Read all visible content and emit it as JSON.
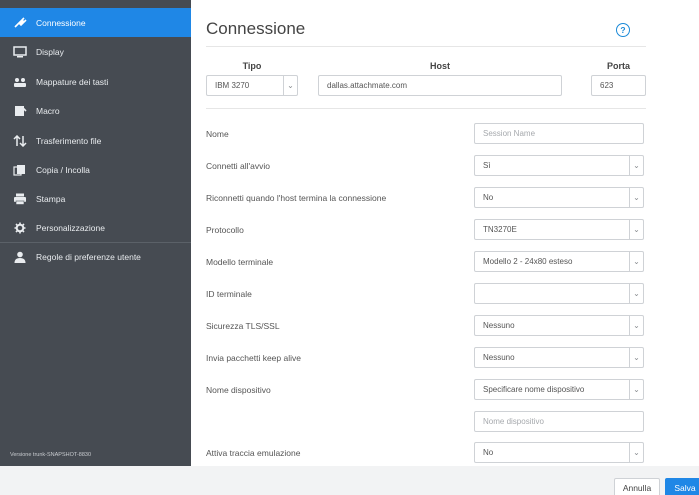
{
  "sidebar": {
    "items": [
      {
        "label": "Connessione",
        "icon": "plug-icon",
        "active": true
      },
      {
        "label": "Display",
        "icon": "monitor-icon"
      },
      {
        "label": "Mappature dei tasti",
        "icon": "keymap-icon"
      },
      {
        "label": "Macro",
        "icon": "macro-icon"
      },
      {
        "label": "Trasferimento file",
        "icon": "transfer-icon"
      },
      {
        "label": "Copia / Incolla",
        "icon": "copy-icon"
      },
      {
        "label": "Stampa",
        "icon": "printer-icon"
      },
      {
        "label": "Personalizzazione",
        "icon": "gear-icon"
      },
      {
        "label": "Regole di preferenze utente",
        "icon": "user-icon"
      }
    ],
    "version": "Versione trunk-SNAPSHOT-8830"
  },
  "main": {
    "title": "Connessione",
    "help_glyph": "?",
    "columns": {
      "tipo": "Tipo",
      "host": "Host",
      "porta": "Porta"
    },
    "tipo_value": "IBM 3270",
    "host_value": "dallas.attachmate.com",
    "porta_value": "623",
    "fields": [
      {
        "label": "Nome",
        "placeholder": "Session Name"
      },
      {
        "label": "Connetti all'avvio",
        "value": "Sì"
      },
      {
        "label": "Riconnetti quando l'host termina la connessione",
        "value": "No"
      },
      {
        "label": "Protocollo",
        "value": "TN3270E"
      },
      {
        "label": "Modello terminale",
        "value": "Modello 2 - 24x80 esteso"
      },
      {
        "label": "ID terminale",
        "value": ""
      },
      {
        "label": "Sicurezza TLS/SSL",
        "value": "Nessuno"
      },
      {
        "label": "Invia pacchetti keep alive",
        "value": "Nessuno"
      },
      {
        "label": "Nome dispositivo",
        "value": "Specificare nome dispositivo"
      },
      {
        "label": "",
        "placeholder": "Nome dispositivo"
      },
      {
        "label": "Attiva traccia emulazione",
        "value": "No"
      }
    ]
  },
  "footer": {
    "cancel": "Annulla",
    "save": "Salva"
  },
  "colors": {
    "sidebar_bg": "#464b52",
    "accent": "#1f87e6",
    "help": "#1b8ad8"
  }
}
